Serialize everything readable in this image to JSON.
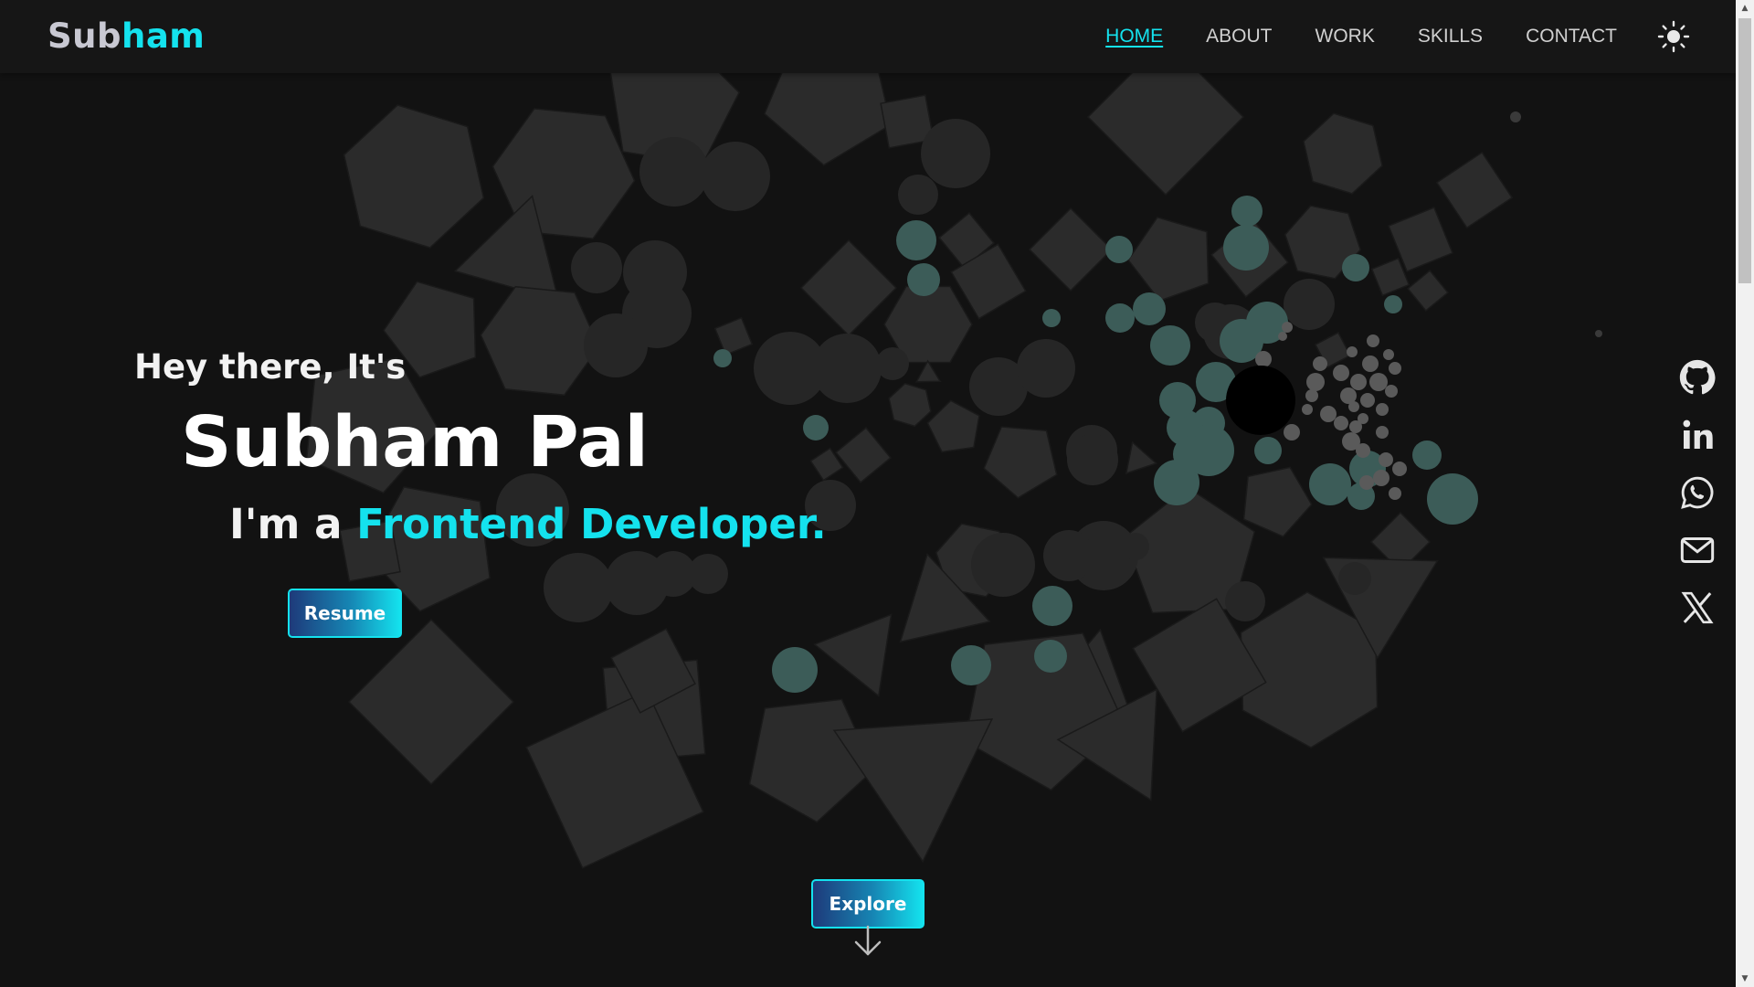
{
  "brand": {
    "logo_part1": "Sub",
    "logo_part2": "ham"
  },
  "nav": {
    "items": [
      {
        "label": "HOME",
        "active": true
      },
      {
        "label": "ABOUT",
        "active": false
      },
      {
        "label": "WORK",
        "active": false
      },
      {
        "label": "SKILLS",
        "active": false
      },
      {
        "label": "CONTACT",
        "active": false
      }
    ],
    "theme_icon": "sun-icon"
  },
  "hero": {
    "greeting": "Hey there, It's",
    "name": "Subham Pal",
    "role_prefix": "I'm a ",
    "role_highlight": "Frontend Developer.",
    "resume_label": "Resume"
  },
  "explore": {
    "label": "Explore",
    "icon": "arrow-down-icon"
  },
  "socials": [
    {
      "name": "github",
      "icon": "github-icon"
    },
    {
      "name": "linkedin",
      "icon": "linkedin-icon"
    },
    {
      "name": "whatsapp",
      "icon": "whatsapp-icon"
    },
    {
      "name": "email",
      "icon": "mail-icon"
    },
    {
      "name": "x",
      "icon": "x-icon"
    }
  ],
  "colors": {
    "background": "#121212",
    "navbar": "#161616",
    "accent": "#14e2ee",
    "shape_fill": "#2b2b2b",
    "bubble_teal": "#3c5c58",
    "bubble_dark": "#262626",
    "bubble_grey": "#5a5a5a"
  }
}
